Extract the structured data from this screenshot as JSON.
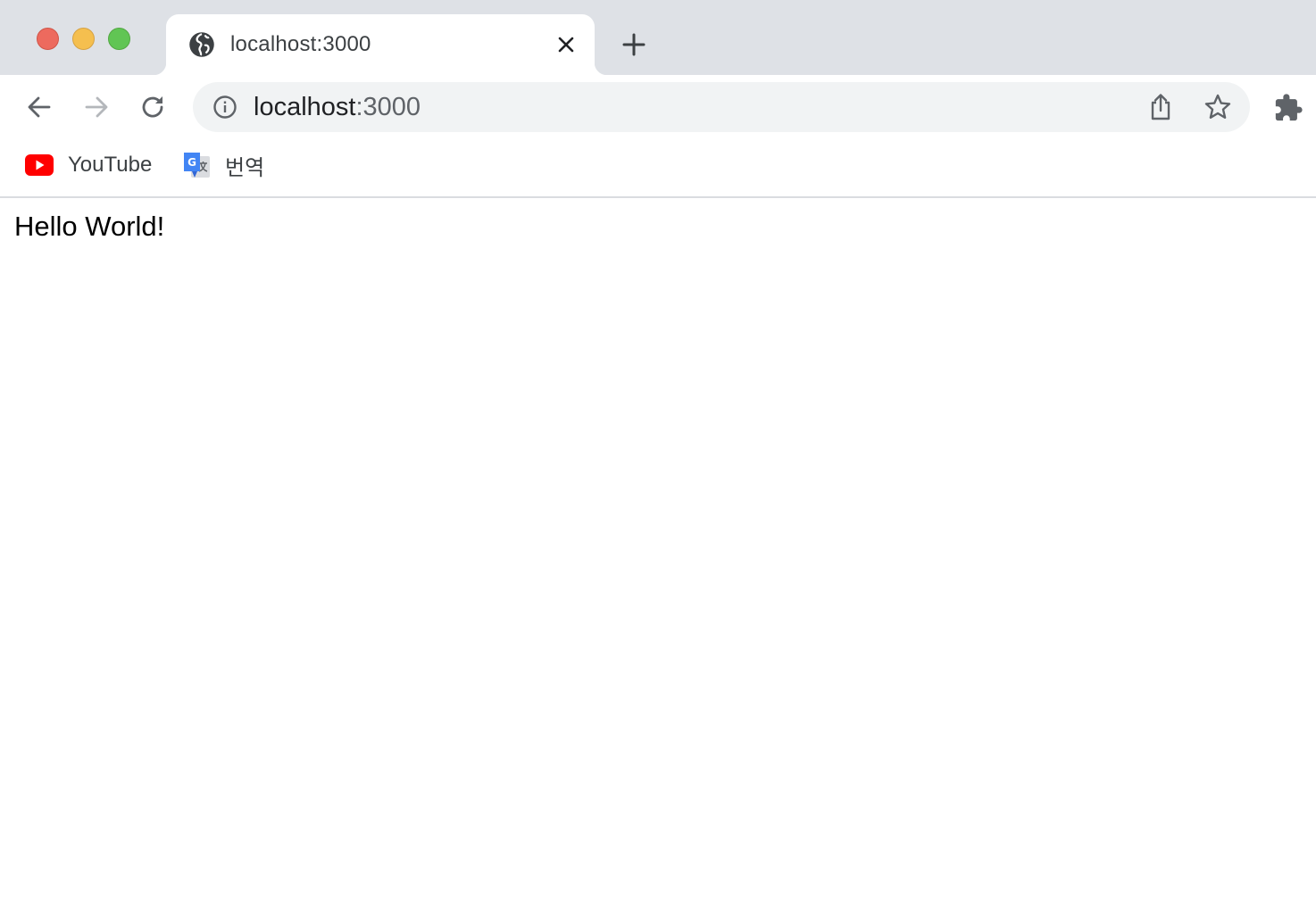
{
  "window": {
    "traffic_lights": [
      "close",
      "minimize",
      "maximize"
    ]
  },
  "tabs": [
    {
      "title": "localhost:3000",
      "icon": "globe-icon",
      "active": true
    }
  ],
  "toolbar": {
    "address": {
      "host": "localhost",
      "port": ":3000",
      "info_icon": "info-icon"
    }
  },
  "bookmarks": [
    {
      "label": "YouTube",
      "icon": "youtube-icon"
    },
    {
      "label": "번역",
      "icon": "google-translate-icon"
    }
  ],
  "page": {
    "text": "Hello World!"
  },
  "colors": {
    "tabstrip": "#dee1e6",
    "omnibox": "#f1f3f4",
    "close_light": "#ed6a5e",
    "minimize_light": "#f5bf4f",
    "maximize_light": "#61c554",
    "youtube_red": "#ff0000",
    "translate_blue": "#4285f4"
  }
}
